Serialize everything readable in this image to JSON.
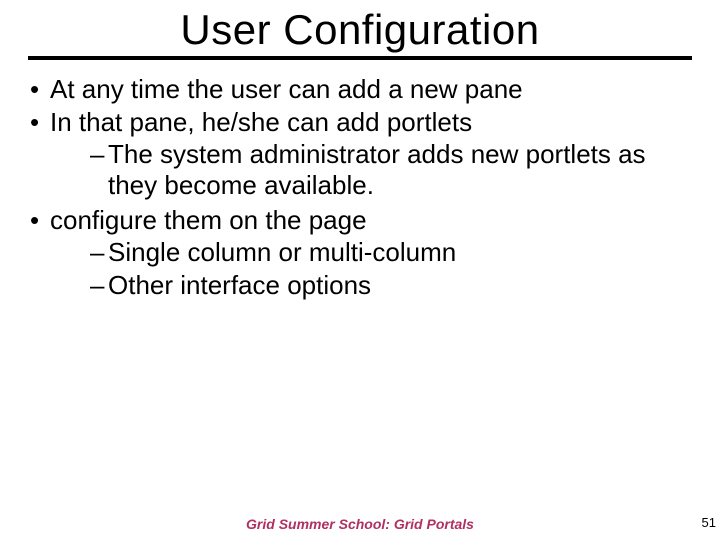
{
  "title": "User Configuration",
  "bullets": {
    "b1": "At any time the user can add a new pane",
    "b2": "In that pane, he/she can add portlets",
    "b2_sub1": "The system administrator adds new portlets as they become available.",
    "b3": "configure them on the page",
    "b3_sub1": "Single column or multi-column",
    "b3_sub2": "Other interface options"
  },
  "footer": "Grid Summer School: Grid Portals",
  "page_number": "51"
}
